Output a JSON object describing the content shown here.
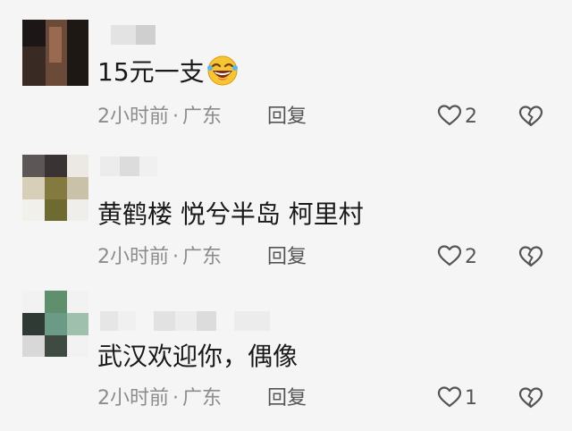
{
  "comments": [
    {
      "text": "15元一支",
      "emoji": "laughing-emoji",
      "time": "2小时前",
      "location": "广东",
      "separator": "·",
      "reply_label": "回复",
      "likes": "2"
    },
    {
      "text": "黄鹤楼 悦兮半岛  柯里村",
      "time": "2小时前",
      "location": "广东",
      "separator": "·",
      "reply_label": "回复",
      "likes": "2"
    },
    {
      "text": "武汉欢迎你，偶像",
      "time": "2小时前",
      "location": "广东",
      "separator": "·",
      "reply_label": "回复",
      "likes": "1"
    }
  ],
  "icons": {
    "like": "heart-outline-icon",
    "dislike": "broken-heart-icon"
  },
  "colors": {
    "background": "#f5f5f5",
    "text": "#1a1a1a",
    "meta": "#8c8c8c",
    "icon": "#555555"
  }
}
